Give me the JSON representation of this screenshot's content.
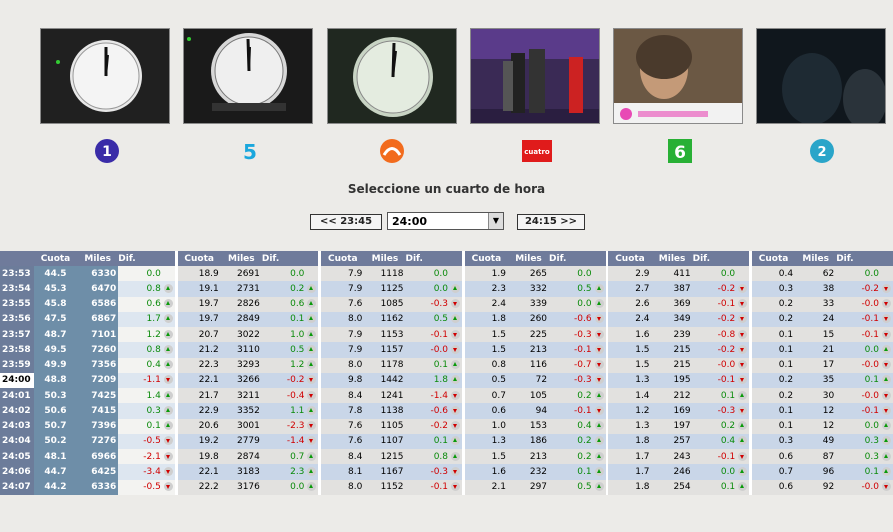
{
  "caption": "Seleccione un cuarto de hora",
  "nav": {
    "prev_label": "<< 23:45",
    "selected": "24:00",
    "next_label": "24:15 >>"
  },
  "channels": [
    {
      "logo_icon": "la1-logo-icon",
      "logo_text": "1",
      "logo_color": "#3a2ca8"
    },
    {
      "logo_icon": "telecinco-logo-icon",
      "logo_text": "5",
      "logo_color": "#1aa7dd"
    },
    {
      "logo_icon": "antena3-logo-icon",
      "logo_text": "",
      "logo_color": "#f26b1d"
    },
    {
      "logo_icon": "cuatro-logo-icon",
      "logo_text": "cuatro",
      "logo_color": "#e01b1b"
    },
    {
      "logo_icon": "lasexta-logo-icon",
      "logo_text": "6",
      "logo_color": "#28b035"
    },
    {
      "logo_icon": "la2-logo-icon",
      "logo_text": "2",
      "logo_color": "#2aa5c9"
    }
  ],
  "columns": [
    "Cuota",
    "Miles",
    "Dif."
  ],
  "selected_row": "24:00",
  "rows": [
    {
      "time": "23:53",
      "c": [
        [
          "44.5",
          "6330",
          "0.0",
          ""
        ],
        [
          "18.9",
          "2691",
          "0.0",
          ""
        ],
        [
          "7.9",
          "1118",
          "0.0",
          ""
        ],
        [
          "1.9",
          "265",
          "0.0",
          ""
        ],
        [
          "2.9",
          "411",
          "0.0",
          ""
        ],
        [
          "0.4",
          "62",
          "0.0",
          ""
        ]
      ]
    },
    {
      "time": "23:54",
      "c": [
        [
          "45.3",
          "6470",
          "0.8",
          "up"
        ],
        [
          "19.1",
          "2731",
          "0.2",
          "up"
        ],
        [
          "7.9",
          "1125",
          "0.0",
          "up"
        ],
        [
          "2.3",
          "332",
          "0.5",
          "up"
        ],
        [
          "2.7",
          "387",
          "-0.2",
          "down"
        ],
        [
          "0.3",
          "38",
          "-0.2",
          "down"
        ]
      ]
    },
    {
      "time": "23:55",
      "c": [
        [
          "45.8",
          "6586",
          "0.6",
          "up"
        ],
        [
          "19.7",
          "2826",
          "0.6",
          "up"
        ],
        [
          "7.6",
          "1085",
          "-0.3",
          "down"
        ],
        [
          "2.4",
          "339",
          "0.0",
          "up"
        ],
        [
          "2.6",
          "369",
          "-0.1",
          "down"
        ],
        [
          "0.2",
          "33",
          "-0.0",
          "down"
        ]
      ]
    },
    {
      "time": "23:56",
      "c": [
        [
          "47.5",
          "6867",
          "1.7",
          "up"
        ],
        [
          "19.7",
          "2849",
          "0.1",
          "up"
        ],
        [
          "8.0",
          "1162",
          "0.5",
          "up"
        ],
        [
          "1.8",
          "260",
          "-0.6",
          "down"
        ],
        [
          "2.4",
          "349",
          "-0.2",
          "down"
        ],
        [
          "0.2",
          "24",
          "-0.1",
          "down"
        ]
      ]
    },
    {
      "time": "23:57",
      "c": [
        [
          "48.7",
          "7101",
          "1.2",
          "up"
        ],
        [
          "20.7",
          "3022",
          "1.0",
          "up"
        ],
        [
          "7.9",
          "1153",
          "-0.1",
          "down"
        ],
        [
          "1.5",
          "225",
          "-0.3",
          "down"
        ],
        [
          "1.6",
          "239",
          "-0.8",
          "down"
        ],
        [
          "0.1",
          "15",
          "-0.1",
          "down"
        ]
      ]
    },
    {
      "time": "23:58",
      "c": [
        [
          "49.5",
          "7260",
          "0.8",
          "up"
        ],
        [
          "21.2",
          "3110",
          "0.5",
          "up"
        ],
        [
          "7.9",
          "1157",
          "-0.0",
          "down"
        ],
        [
          "1.5",
          "213",
          "-0.1",
          "down"
        ],
        [
          "1.5",
          "215",
          "-0.2",
          "down"
        ],
        [
          "0.1",
          "21",
          "0.0",
          "up"
        ]
      ]
    },
    {
      "time": "23:59",
      "c": [
        [
          "49.9",
          "7356",
          "0.4",
          "up"
        ],
        [
          "22.3",
          "3293",
          "1.2",
          "up"
        ],
        [
          "8.0",
          "1178",
          "0.1",
          "up"
        ],
        [
          "0.8",
          "116",
          "-0.7",
          "down"
        ],
        [
          "1.5",
          "215",
          "-0.0",
          "down"
        ],
        [
          "0.1",
          "17",
          "-0.0",
          "down"
        ]
      ]
    },
    {
      "time": "24:00",
      "c": [
        [
          "48.8",
          "7209",
          "-1.1",
          "down"
        ],
        [
          "22.1",
          "3266",
          "-0.2",
          "down"
        ],
        [
          "9.8",
          "1442",
          "1.8",
          "up"
        ],
        [
          "0.5",
          "72",
          "-0.3",
          "down"
        ],
        [
          "1.3",
          "195",
          "-0.1",
          "down"
        ],
        [
          "0.2",
          "35",
          "0.1",
          "up"
        ]
      ]
    },
    {
      "time": "24:01",
      "c": [
        [
          "50.3",
          "7425",
          "1.4",
          "up"
        ],
        [
          "21.7",
          "3211",
          "-0.4",
          "down"
        ],
        [
          "8.4",
          "1241",
          "-1.4",
          "down"
        ],
        [
          "0.7",
          "105",
          "0.2",
          "up"
        ],
        [
          "1.4",
          "212",
          "0.1",
          "up"
        ],
        [
          "0.2",
          "30",
          "-0.0",
          "down"
        ]
      ]
    },
    {
      "time": "24:02",
      "c": [
        [
          "50.6",
          "7415",
          "0.3",
          "up"
        ],
        [
          "22.9",
          "3352",
          "1.1",
          "up"
        ],
        [
          "7.8",
          "1138",
          "-0.6",
          "down"
        ],
        [
          "0.6",
          "94",
          "-0.1",
          "down"
        ],
        [
          "1.2",
          "169",
          "-0.3",
          "down"
        ],
        [
          "0.1",
          "12",
          "-0.1",
          "down"
        ]
      ]
    },
    {
      "time": "24:03",
      "c": [
        [
          "50.7",
          "7396",
          "0.1",
          "up"
        ],
        [
          "20.6",
          "3001",
          "-2.3",
          "down"
        ],
        [
          "7.6",
          "1105",
          "-0.2",
          "down"
        ],
        [
          "1.0",
          "153",
          "0.4",
          "up"
        ],
        [
          "1.3",
          "197",
          "0.2",
          "up"
        ],
        [
          "0.1",
          "12",
          "0.0",
          "up"
        ]
      ]
    },
    {
      "time": "24:04",
      "c": [
        [
          "50.2",
          "7276",
          "-0.5",
          "down"
        ],
        [
          "19.2",
          "2779",
          "-1.4",
          "down"
        ],
        [
          "7.6",
          "1107",
          "0.1",
          "up"
        ],
        [
          "1.3",
          "186",
          "0.2",
          "up"
        ],
        [
          "1.8",
          "257",
          "0.4",
          "up"
        ],
        [
          "0.3",
          "49",
          "0.3",
          "up"
        ]
      ]
    },
    {
      "time": "24:05",
      "c": [
        [
          "48.1",
          "6966",
          "-2.1",
          "down"
        ],
        [
          "19.8",
          "2874",
          "0.7",
          "up"
        ],
        [
          "8.4",
          "1215",
          "0.8",
          "up"
        ],
        [
          "1.5",
          "213",
          "0.2",
          "up"
        ],
        [
          "1.7",
          "243",
          "-0.1",
          "down"
        ],
        [
          "0.6",
          "87",
          "0.3",
          "up"
        ]
      ]
    },
    {
      "time": "24:06",
      "c": [
        [
          "44.7",
          "6425",
          "-3.4",
          "down"
        ],
        [
          "22.1",
          "3183",
          "2.3",
          "up"
        ],
        [
          "8.1",
          "1167",
          "-0.3",
          "down"
        ],
        [
          "1.6",
          "232",
          "0.1",
          "up"
        ],
        [
          "1.7",
          "246",
          "0.0",
          "up"
        ],
        [
          "0.7",
          "96",
          "0.1",
          "up"
        ]
      ]
    },
    {
      "time": "24:07",
      "c": [
        [
          "44.2",
          "6336",
          "-0.5",
          "down"
        ],
        [
          "22.2",
          "3176",
          "0.0",
          "up"
        ],
        [
          "8.0",
          "1152",
          "-0.1",
          "down"
        ],
        [
          "2.1",
          "297",
          "0.5",
          "up"
        ],
        [
          "1.8",
          "254",
          "0.1",
          "up"
        ],
        [
          "0.6",
          "92",
          "-0.0",
          "down"
        ]
      ]
    }
  ]
}
